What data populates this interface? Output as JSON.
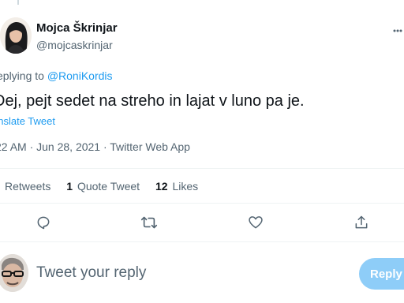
{
  "tweet": {
    "author_name": "Mojca Škrinjar",
    "author_handle": "@mojcaskrinjar",
    "more_icon": "more-icon",
    "replying_prefix": "eplying to ",
    "replying_to": "@RoniKordis",
    "text": "Dej, pejt sedet na streho in lajat v luno pa je.",
    "translate_label": "anslate Tweet",
    "meta": "22 AM · Jun 28, 2021 · Twitter Web App"
  },
  "stats": {
    "retweets_label": "Retweets",
    "quote_count": "1",
    "quote_label": "Quote Tweet",
    "likes_count": "12",
    "likes_label": "Likes"
  },
  "actions": [
    "reply-icon",
    "retweet-icon",
    "like-icon",
    "share-icon"
  ],
  "composer": {
    "placeholder": "Tweet your reply",
    "button_label": "Reply"
  },
  "colors": {
    "accent": "#1d9bf0",
    "reply_button_disabled": "#8ecdf8",
    "secondary_text": "#536471"
  }
}
